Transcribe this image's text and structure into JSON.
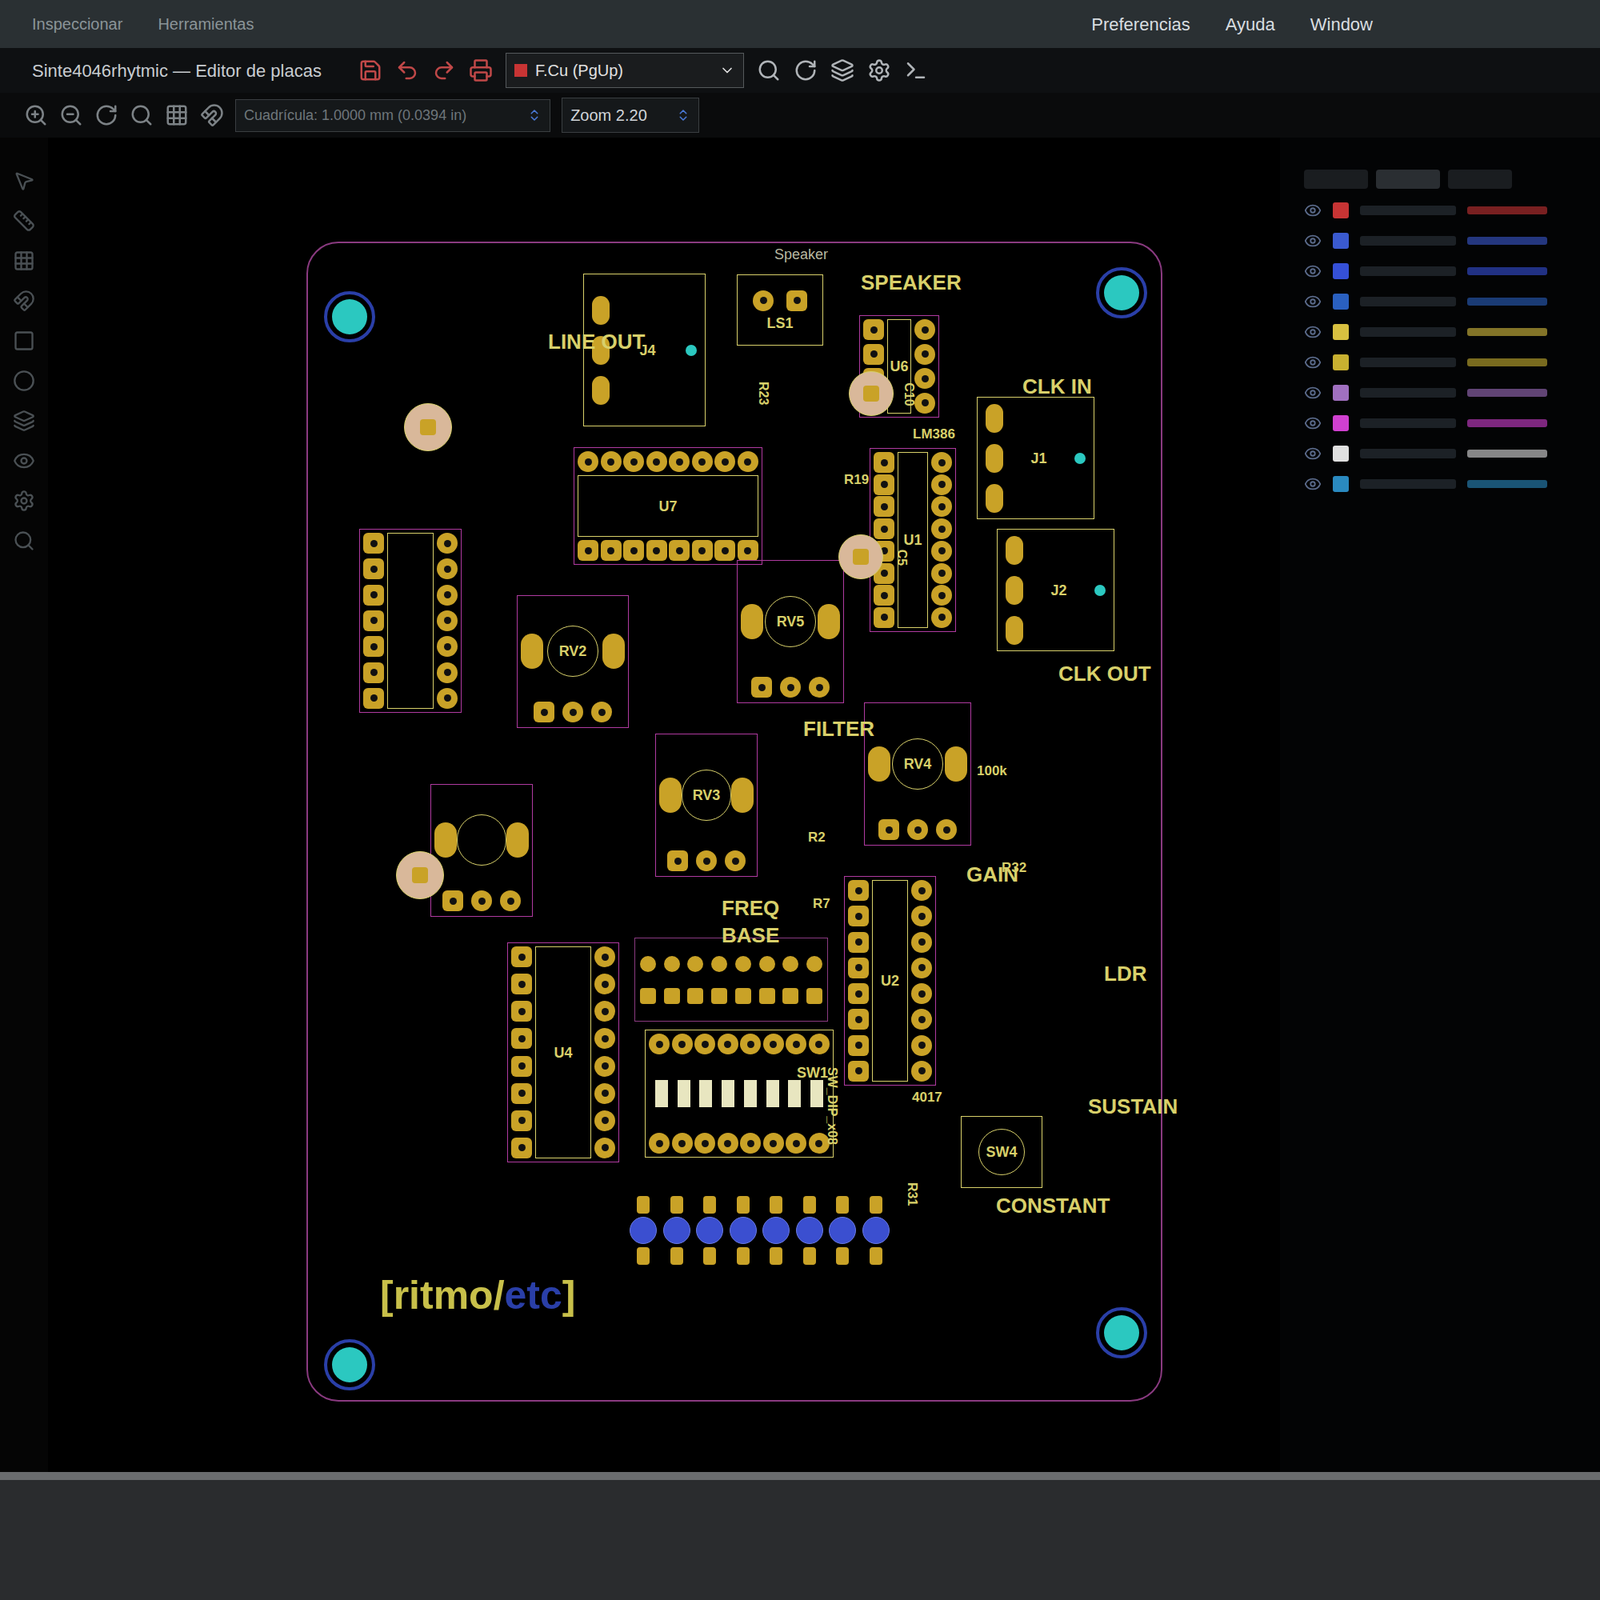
{
  "menu": {
    "items": [
      {
        "label": "Inspeccionar"
      },
      {
        "label": "Herramientas"
      }
    ],
    "right": [
      "Preferencias",
      "Ayuda",
      "Window"
    ]
  },
  "window": {
    "title": "Sinte4046rhytmic — Editor de placas"
  },
  "toolbar": {
    "layer": {
      "label": "F.Cu (PgUp)",
      "color": "#c83434"
    },
    "zoom": "Zoom 2.20",
    "grid": "Cuadrícula: 1.0000 mm (0.0394 in)"
  },
  "board": {
    "components": [
      {
        "ref": "U6",
        "kind": "ic",
        "pins": 8
      },
      {
        "ref": "U1",
        "kind": "ic",
        "pins": 16
      },
      {
        "ref": "U7",
        "kind": "ic-h",
        "pins": 16
      },
      {
        "ref": "U2",
        "kind": "ic",
        "pins": 16
      },
      {
        "ref": "U4",
        "kind": "ic",
        "pins": 16
      },
      {
        "ref": "",
        "kind": "ic",
        "pins": 14
      },
      {
        "ref": "RV5",
        "kind": "pot",
        "pins": 3
      },
      {
        "ref": "RV2",
        "kind": "pot",
        "pins": 3
      },
      {
        "ref": "RV3",
        "kind": "pot",
        "pins": 3
      },
      {
        "ref": "RV4",
        "kind": "pot",
        "pins": 3
      },
      {
        "ref": "",
        "kind": "pot",
        "pins": 3
      },
      {
        "ref": "J1",
        "kind": "jack",
        "pins": 3
      },
      {
        "ref": "J2",
        "kind": "jack",
        "pins": 3
      },
      {
        "ref": "J4",
        "kind": "jack",
        "pins": 3
      },
      {
        "ref": "LS1",
        "kind": "speaker",
        "pins": 2
      },
      {
        "ref": "SW1",
        "kind": "dipswitch",
        "pins": 16
      },
      {
        "ref": "SW4",
        "kind": "button",
        "pins": 4
      },
      {
        "ref": "C10",
        "kind": "cap",
        "pins": 2
      },
      {
        "ref": "C5",
        "kind": "cap",
        "pins": 2
      },
      {
        "ref": "",
        "kind": "cap",
        "pins": 2
      },
      {
        "ref": "",
        "kind": "cap",
        "pins": 2
      }
    ],
    "silkscreen": [
      {
        "text": "Speaker",
        "kind": "note"
      },
      {
        "text": "SPEAKER",
        "kind": "label"
      },
      {
        "text": "LM386",
        "kind": "ref"
      },
      {
        "text": "CLK IN",
        "kind": "label"
      },
      {
        "text": "CLK OUT",
        "kind": "label"
      },
      {
        "text": "LINE OUT",
        "kind": "label"
      },
      {
        "text": "FILTER",
        "kind": "label"
      },
      {
        "text": "GAIN",
        "kind": "label"
      },
      {
        "text": "FREQ",
        "kind": "label"
      },
      {
        "text": "BASE",
        "kind": "label"
      },
      {
        "text": "100k",
        "kind": "ref"
      },
      {
        "text": "4017",
        "kind": "ref"
      },
      {
        "text": "SW_DIP_x08",
        "kind": "vertical"
      },
      {
        "text": "CONSTANT",
        "kind": "label"
      },
      {
        "text": "SUSTAIN",
        "kind": "label"
      },
      {
        "text": "LDR",
        "kind": "label"
      },
      {
        "text": "R19",
        "kind": "ref"
      },
      {
        "text": "R2",
        "kind": "ref"
      },
      {
        "text": "R7",
        "kind": "ref"
      },
      {
        "text": "R31",
        "kind": "vertical"
      },
      {
        "text": "R32",
        "kind": "ref"
      },
      {
        "text": "R23",
        "kind": "vertical"
      }
    ],
    "logo": [
      {
        "text": "[ritmo/",
        "color": "#c8c04a"
      },
      {
        "text": "etc",
        "color": "#2a3fa8"
      },
      {
        "text": "]",
        "color": "#c8c04a"
      }
    ]
  },
  "layers_panel": {
    "layers": [
      {
        "color": "#c83434",
        "visible": true
      },
      {
        "color": "#3a5ad0",
        "visible": true
      },
      {
        "color": "#3550d8",
        "visible": true
      },
      {
        "color": "#2a60c0",
        "visible": true
      },
      {
        "color": "#d8c040",
        "visible": true
      },
      {
        "color": "#c8b030",
        "visible": true
      },
      {
        "color": "#a070c0",
        "visible": true
      },
      {
        "color": "#d040d0",
        "visible": true
      },
      {
        "color": "#e0e0e0",
        "visible": true
      },
      {
        "color": "#2a8ac0",
        "visible": true
      }
    ]
  }
}
